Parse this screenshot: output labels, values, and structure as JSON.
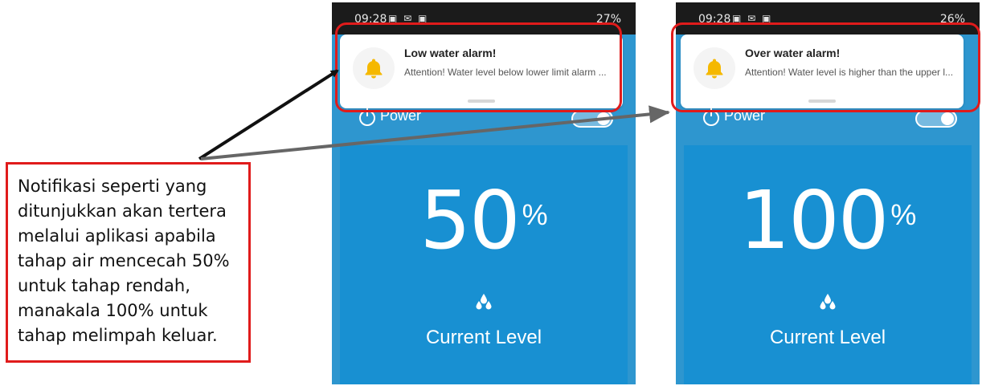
{
  "caption": {
    "text": "Notifikasi seperti yang\nditunjukkan akan tertera\nmelalui aplikasi apabila\ntahap air mencecah 50%\nuntuk tahap rendah,\nmanakala 100% untuk\ntahap melimpah keluar."
  },
  "colors": {
    "highlight": "#e01b1b",
    "app_blue": "#2e96cf",
    "card_blue": "#1890d2",
    "bell": "#f5b800"
  },
  "phones": [
    {
      "status_time": "09:28",
      "status_battery": "27%",
      "power_label": "Power",
      "level_value": "50",
      "level_unit": "%",
      "level_label": "Current Level",
      "level_icon": "water-drops-icon",
      "notification": {
        "icon": "bell-icon",
        "title": "Low water alarm!",
        "body": "Attention! Water level below lower limit alarm ..."
      }
    },
    {
      "status_time": "09:28",
      "status_battery": "26%",
      "power_label": "Power",
      "level_value": "100",
      "level_unit": "%",
      "level_label": "Current Level",
      "level_icon": "water-drops-icon",
      "notification": {
        "icon": "bell-icon",
        "title": "Over water alarm!",
        "body": "Attention! Water level is higher than the upper l..."
      }
    }
  ]
}
